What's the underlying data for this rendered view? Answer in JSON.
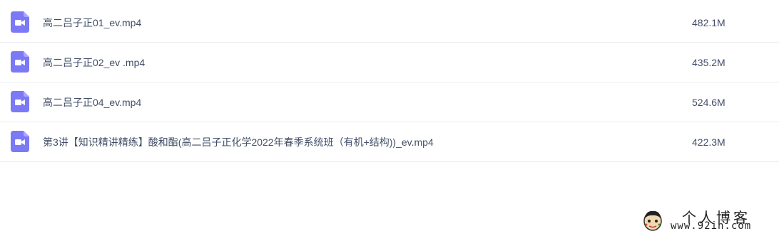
{
  "files": [
    {
      "name": "高二吕子正01_ev.mp4",
      "size": "482.1M",
      "icon": "video-file-icon"
    },
    {
      "name": "高二吕子正02_ev .mp4",
      "size": "435.2M",
      "icon": "video-file-icon"
    },
    {
      "name": "高二吕子正04_ev.mp4",
      "size": "524.6M",
      "icon": "video-file-icon"
    },
    {
      "name": "第3讲【知识精讲精练】酸和酯(高二吕子正化学2022年春季系统班（有机+结构))_ev.mp4",
      "size": "422.3M",
      "icon": "video-file-icon"
    }
  ],
  "watermark": {
    "title": "个人博客",
    "url": "www.92in.com"
  },
  "colors": {
    "icon_bg": "#7b79f5",
    "text": "#424e67",
    "divider": "#ebedf0"
  }
}
